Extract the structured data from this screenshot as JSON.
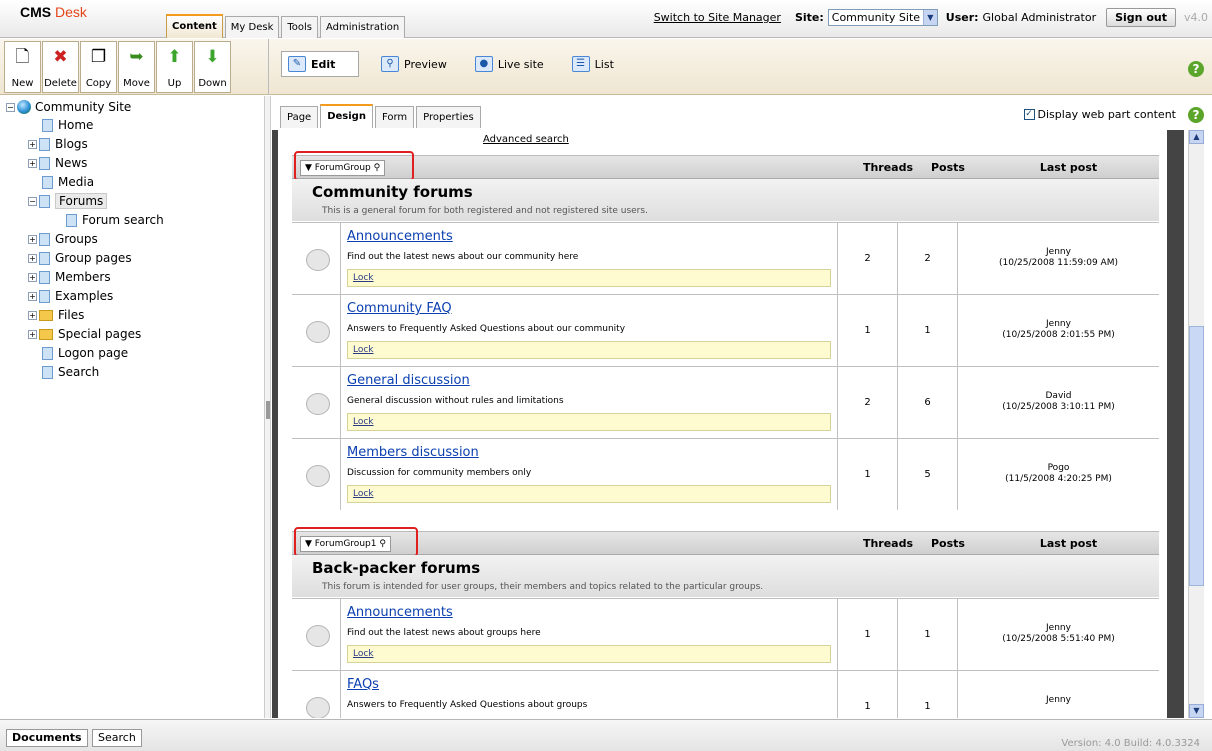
{
  "header": {
    "brand": "CMS",
    "brand2": "Desk",
    "tabs": [
      "Content",
      "My Desk",
      "Tools",
      "Administration"
    ],
    "switch_link": "Switch to Site Manager",
    "site_label": "Site:",
    "site_value": "Community Site",
    "user_label": "User:",
    "user_value": "Global Administrator",
    "signout": "Sign out",
    "version": "v4.0"
  },
  "toolbar": {
    "buttons": [
      "New",
      "Delete",
      "Copy",
      "Move",
      "Up",
      "Down"
    ],
    "modes": [
      "Edit",
      "Preview",
      "Live site",
      "List"
    ]
  },
  "tree": {
    "root": "Community Site",
    "items": [
      "Home",
      "Blogs",
      "News",
      "Media",
      "Forums",
      "Forum search",
      "Groups",
      "Group pages",
      "Members",
      "Examples",
      "Files",
      "Special pages",
      "Logon page",
      "Search"
    ]
  },
  "content": {
    "subtabs": [
      "Page",
      "Design",
      "Form",
      "Properties"
    ],
    "display_wp": "Display web part content",
    "advanced_search": "Advanced search"
  },
  "cols": {
    "threads": "Threads",
    "posts": "Posts",
    "last": "Last post"
  },
  "group1": {
    "wp": "ForumGroup",
    "title": "Community forums",
    "desc": "This is a general forum for both registered and not registered site users.",
    "forums": [
      {
        "name": "Announcements",
        "desc": "Find out the latest news about our community here",
        "lock": "Lock",
        "threads": "2",
        "posts": "2",
        "user": "Jenny",
        "date": "(10/25/2008 11:59:09 AM)"
      },
      {
        "name": "Community FAQ",
        "desc": "Answers to Frequently Asked Questions about our community",
        "lock": "Lock",
        "threads": "1",
        "posts": "1",
        "user": "Jenny",
        "date": "(10/25/2008 2:01:55 PM)"
      },
      {
        "name": "General discussion",
        "desc": "General discussion without rules and limitations",
        "lock": "Lock",
        "threads": "2",
        "posts": "6",
        "user": "David",
        "date": "(10/25/2008 3:10:11 PM)"
      },
      {
        "name": "Members discussion",
        "desc": "Discussion for community members only",
        "lock": "Lock",
        "threads": "1",
        "posts": "5",
        "user": "Pogo",
        "date": "(11/5/2008 4:20:25 PM)"
      }
    ]
  },
  "group2": {
    "wp": "ForumGroup1",
    "title": "Back-packer forums",
    "desc": "This forum is intended for user groups, their members and topics related to the particular groups.",
    "forums": [
      {
        "name": "Announcements",
        "desc": "Find out the latest news about groups here",
        "lock": "Lock",
        "threads": "1",
        "posts": "1",
        "user": "Jenny",
        "date": "(10/25/2008 5:51:40 PM)"
      },
      {
        "name": "FAQs",
        "desc": "Answers to Frequently Asked Questions about groups",
        "lock": "",
        "threads": "1",
        "posts": "1",
        "user": "Jenny",
        "date": ""
      }
    ]
  },
  "bottom": {
    "tabs": [
      "Documents",
      "Search"
    ],
    "version": "Version: 4.0 Build: 4.0.3324"
  }
}
